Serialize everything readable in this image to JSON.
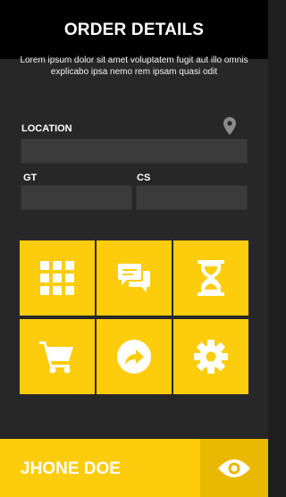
{
  "header": {
    "title": "ORDER DETAILS"
  },
  "main": {
    "description": "Lorem ipsum dolor sit amet voluptatem fugit aut illo omnis explicabo ipsa nemo rem ipsam quasi odit",
    "location_label": "LOCATION",
    "location_value": "",
    "gt_label": "GT",
    "gt_value": "",
    "cs_label": "CS",
    "cs_value": "",
    "tiles": [
      {
        "icon": "grid-icon"
      },
      {
        "icon": "chat-icon"
      },
      {
        "icon": "hourglass-icon"
      },
      {
        "icon": "cart-icon"
      },
      {
        "icon": "share-icon"
      },
      {
        "icon": "gear-icon"
      }
    ]
  },
  "footer": {
    "name": "JHONE DOE",
    "icon": "eye-icon"
  },
  "colors": {
    "accent": "#fdcc0d",
    "accent_dark": "#e9b801",
    "header_bg": "#000000",
    "panel_bg": "#272727",
    "field_bg": "#3b3b3b"
  }
}
